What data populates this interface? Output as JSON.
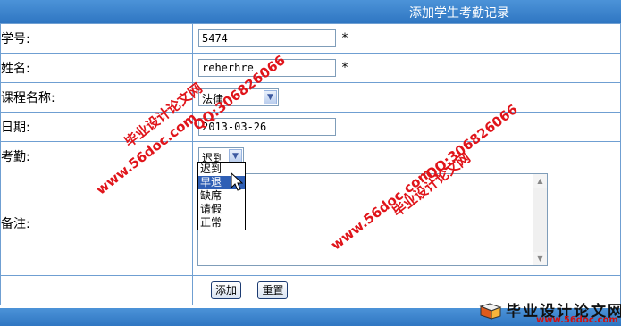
{
  "header": {
    "title": "添加学生考勤记录"
  },
  "form": {
    "student_id_label": "学号:",
    "student_id_value": "5474",
    "name_label": "姓名:",
    "name_value": "reherhre",
    "required_mark": "*",
    "course_label": "课程名称:",
    "course_value": "法律",
    "date_label": "日期:",
    "date_value": "2013-03-26",
    "attendance_label": "考勤:",
    "attendance_value": "迟到",
    "attendance_options": [
      "迟到",
      "早退",
      "缺席",
      "请假",
      "正常"
    ],
    "attendance_highlighted": "早退",
    "remark_label": "备注:",
    "remark_value": ""
  },
  "actions": {
    "add_label": "添加",
    "reset_label": "重置"
  },
  "watermarks": {
    "site_url": "www.56doc.com",
    "qq": "QQ:306826066",
    "brand": "毕业设计论文网",
    "logo_text": "毕业设计论文网",
    "logo_url": "www.56doc.com"
  },
  "colors": {
    "bar": "#3a84cf",
    "border": "#6f9fd2",
    "watermark": "#e0141a"
  }
}
